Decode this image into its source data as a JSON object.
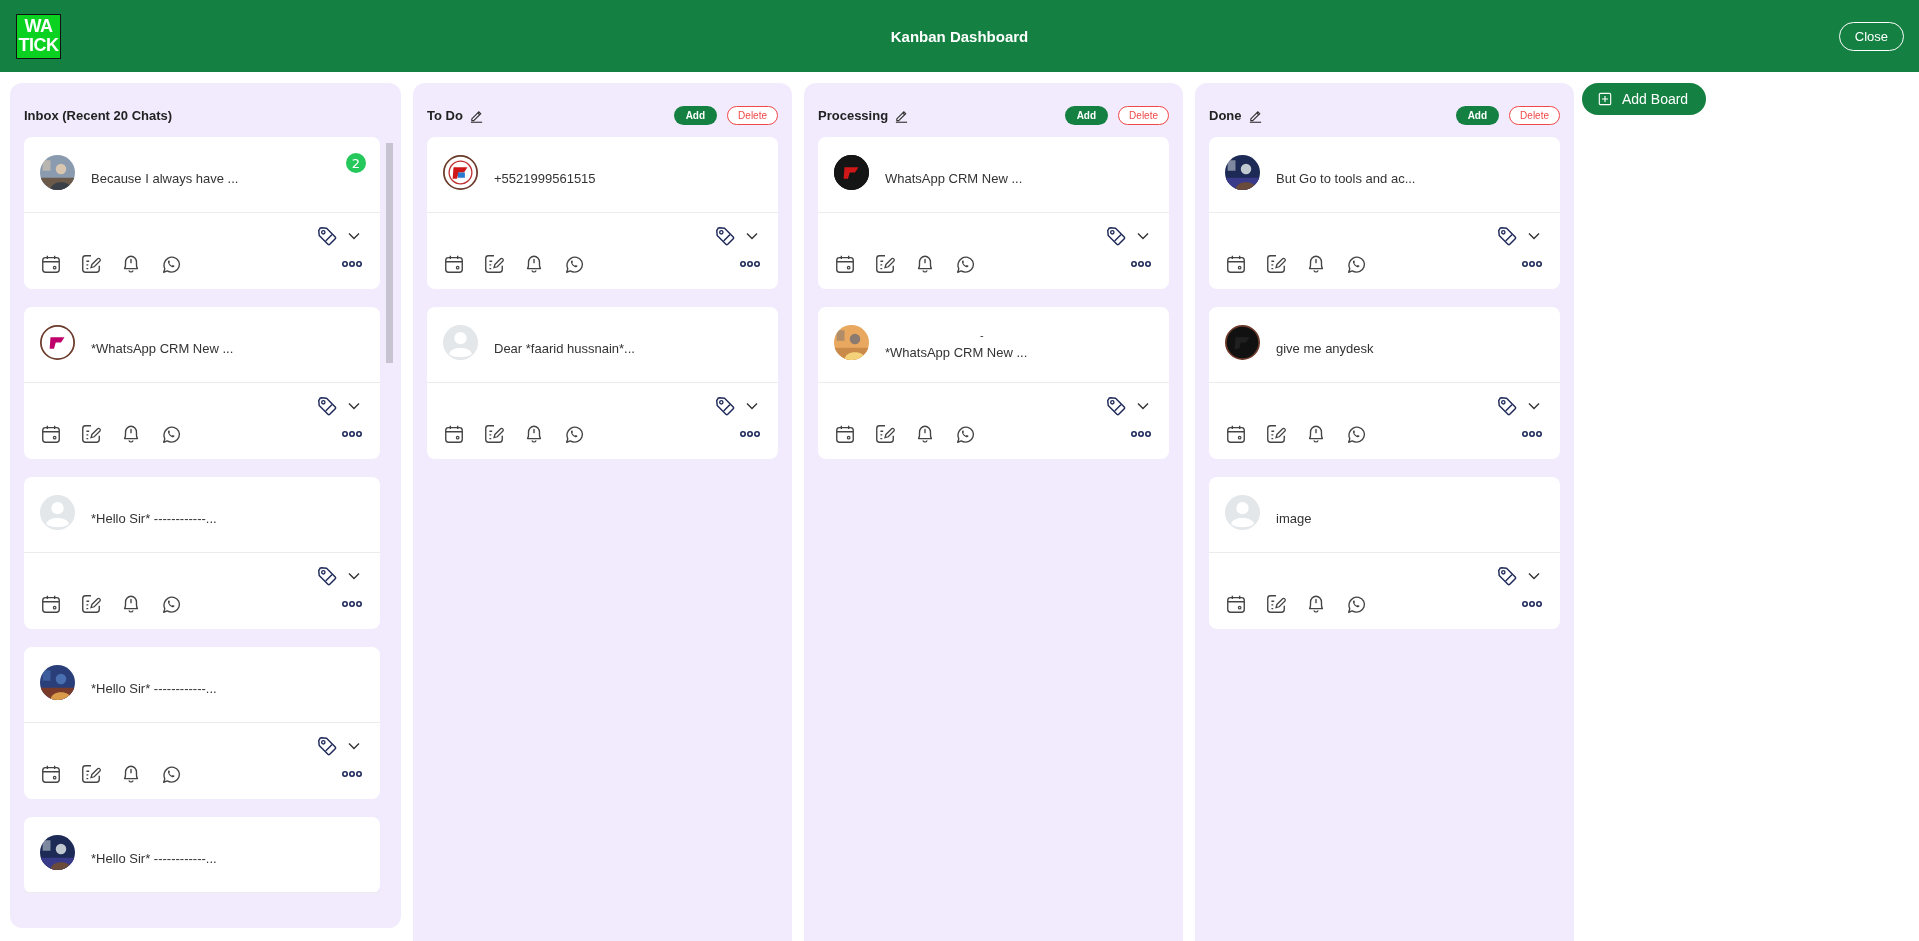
{
  "header": {
    "logo": [
      "WA",
      "TICK"
    ],
    "title": "Kanban Dashboard",
    "close_button": "Close"
  },
  "columns": [
    {
      "kind": "inbox",
      "title": "Inbox (Recent 20 Chats)",
      "cut_off": true,
      "cards": [
        {
          "message": "Because I always have ...",
          "unread": "2"
        },
        {
          "kind": "logo",
          "message": "*WhatsApp CRM New ..."
        },
        {
          "kind": "default",
          "message": "*Hello Sir* ------------..."
        },
        {
          "message": "*Hello Sir* ------------..."
        },
        {
          "message": "*Hello Sir* ------------..."
        }
      ]
    },
    {
      "kind": "board",
      "title": "To Do",
      "add_button": "Add",
      "delete_button": "Delete",
      "cards": [
        {
          "kind": "logo",
          "message": "+5521999561515"
        },
        {
          "kind": "default",
          "message": "Dear *faarid hussnain*..."
        }
      ]
    },
    {
      "kind": "board",
      "title": "Processing",
      "add_button": "Add",
      "delete_button": "Delete",
      "cards": [
        {
          "kind": "logo",
          "message": "WhatsApp CRM New ..."
        },
        {
          "name": "-",
          "message": "*WhatsApp CRM New ..."
        }
      ]
    },
    {
      "kind": "board",
      "title": "Done",
      "add_button": "Add",
      "delete_button": "Delete",
      "cards": [
        {
          "message": "But Go to tools and ac..."
        },
        {
          "kind": "logo",
          "message": "give me anydesk"
        },
        {
          "kind": "default",
          "message": "image"
        }
      ]
    }
  ],
  "add_board_button": "Add Board"
}
